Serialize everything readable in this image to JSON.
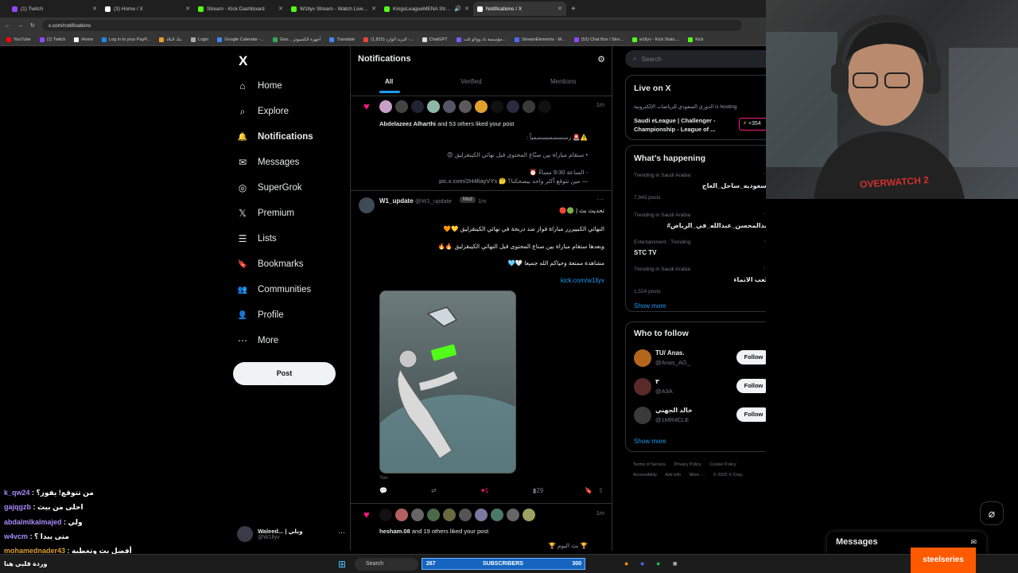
{
  "browser": {
    "tabs": [
      {
        "label": "(1) Twitch",
        "color": "#9146ff"
      },
      {
        "label": "(3) Home / X",
        "color": "#ffffff"
      },
      {
        "label": "Stream - Kick Dashboard",
        "color": "#53fc18"
      },
      {
        "label": "W1llyv Stream - Watch Live on",
        "color": "#53fc18"
      },
      {
        "label": "KingsLeagueMENA Stream",
        "color": "#53fc18"
      },
      {
        "label": "Notifications / X",
        "color": "#ffffff"
      }
    ],
    "url": "x.com/notifications",
    "bookmarks": [
      "YouTube",
      "(1) Twitch",
      "Home",
      "Log in to your PayP...",
      "بنك البلاد",
      "Login",
      "Google Calendar -...",
      "Goo... أجهزة الكمبيوتر",
      "Translate",
      "البريد الوارد (1,815) -...",
      "ChatGPT",
      "مؤسسة باد ووالو للت...",
      "StreamElements - M...",
      "(52) Chat Box / Stre...",
      "w1llyv - Kick Stats,...",
      "Kick"
    ]
  },
  "nav": {
    "logo": "X",
    "items": [
      {
        "label": "Home",
        "icon": "⌂"
      },
      {
        "label": "Explore",
        "icon": "⌕"
      },
      {
        "label": "Notifications",
        "icon": "🔔"
      },
      {
        "label": "Messages",
        "icon": "✉"
      },
      {
        "label": "SuperGrok",
        "icon": "◎"
      },
      {
        "label": "Premium",
        "icon": "𝕏"
      },
      {
        "label": "Lists",
        "icon": "☰"
      },
      {
        "label": "Bookmarks",
        "icon": "🔖"
      },
      {
        "label": "Communities",
        "icon": "👥"
      },
      {
        "label": "Profile",
        "icon": "👤"
      },
      {
        "label": "More",
        "icon": "⋯"
      }
    ],
    "post_label": "Post",
    "account": {
      "name": "Waleed... | ويلي",
      "handle": "@W1llyv",
      "more": "···"
    }
  },
  "feed": {
    "title": "Notifications",
    "tabs": {
      "all": "All",
      "verified": "Verified",
      "mentions": "Mentions"
    },
    "notif1": {
      "time": "1m",
      "text_name": "Abdelazeez Alharthi",
      "text_rest": " and 53 others liked your post",
      "lines": [
        "⚠️🚨 رسسسسسسمياً :",
        "• ستقام مباراة بين صنّاع المحتوى قبل نهائي الكينقزليق 😍",
        "- الساعة 9:30 مساءً ⏰",
        "— مين تتوقع أكثر واحد بيضحكنا؟ 🤔 pic.x.com/2H4fiayVYs"
      ]
    },
    "post": {
      "author": "W1_update",
      "handle": "@W1_update",
      "badge": "Mod",
      "time": "1m",
      "menu": "···",
      "lines": [
        "تحديث بث | 🟢🔴",
        "النهائي الكبييررر مباراة فواز ضد دربحة في نهائي الكينقزليق 💛🧡",
        "وبعدها ستقام مباراة بين صناع المحتوى قبل النهائي الكينقزليق 🔥🔥",
        "مشاهدة ممتعة وحياكم الله جميعا 🤍🩵"
      ],
      "link": "kick.com/w1llyv",
      "image_caption": "You",
      "likes": "1",
      "views": "29"
    },
    "notif2": {
      "time": "1m",
      "text_name": "hesham.08",
      "text_rest": " and 19 others liked your post",
      "line": "🏆 بث اليوم 🏆"
    }
  },
  "right": {
    "search_placeholder": "Search",
    "live": {
      "title": "Live on X",
      "host": "الدوري السعودي للرياضات الإلكترونية is hosting",
      "event": "Saudi eLeague | Challenger - Championship - League of ...",
      "count": "+354"
    },
    "happening": {
      "title": "What’s happening",
      "trends": [
        {
          "context": "Trending in Saudi Arabia",
          "name": "السعوديه_ساحل_العاج",
          "posts": "7,943 posts"
        },
        {
          "context": "Trending in Saudi Arabia",
          "name": "#عبدالمحسن_عبدالله_في_الرياض",
          "posts": ""
        },
        {
          "context": "Entertainment · Trending",
          "name": "STC TV",
          "posts": ""
        },
        {
          "context": "Trending in Saudi Arabia",
          "name": "ملعب الانماء",
          "posts": "1,524 posts"
        }
      ],
      "show_more": "Show more"
    },
    "follow": {
      "title": "Who to follow",
      "users": [
        {
          "name": "TU/ Anas.",
          "handle": "@Anas_AG_",
          "color": "#b5651d"
        },
        {
          "name": "٣",
          "handle": "@A3A",
          "color": "#5a2a2a"
        },
        {
          "name": "خالد الجهني",
          "handle": "@1MR4CLE",
          "color": "#3a3a3a"
        }
      ],
      "button": "Follow",
      "show_more": "Show more"
    },
    "footer": [
      "Terms of Service",
      "Privacy Policy",
      "Cookie Policy",
      "Accessibility",
      "Ads info",
      "More ···",
      "© 2025 X Corp."
    ]
  },
  "messages_dock": "Messages",
  "chat": [
    {
      "user": "k_qw24",
      "msg": "من تتوقع! يفوز؟",
      "color": "#a78bfa"
    },
    {
      "user": "gajqgzb",
      "msg": "احلى من بيث",
      "color": "#a78bfa"
    },
    {
      "user": "abdalmlkalmajed",
      "msg": "ولي",
      "color": "#a78bfa"
    },
    {
      "user": "w4vcm",
      "msg": "متى يبدا ؟",
      "color": "#a78bfa"
    },
    {
      "user": "mohamednader43",
      "msg": "أفضل بث وتغطية",
      "color": "#e0a030"
    }
  ],
  "chat_extra": "وردة قلبي هنا",
  "taskbar": {
    "search": "Search",
    "sub_left": "267",
    "sub_label": "SUBSCRIBERS",
    "sub_right": "300",
    "brand": "steelseries"
  },
  "webcam_text": "OVERWATCH 2"
}
